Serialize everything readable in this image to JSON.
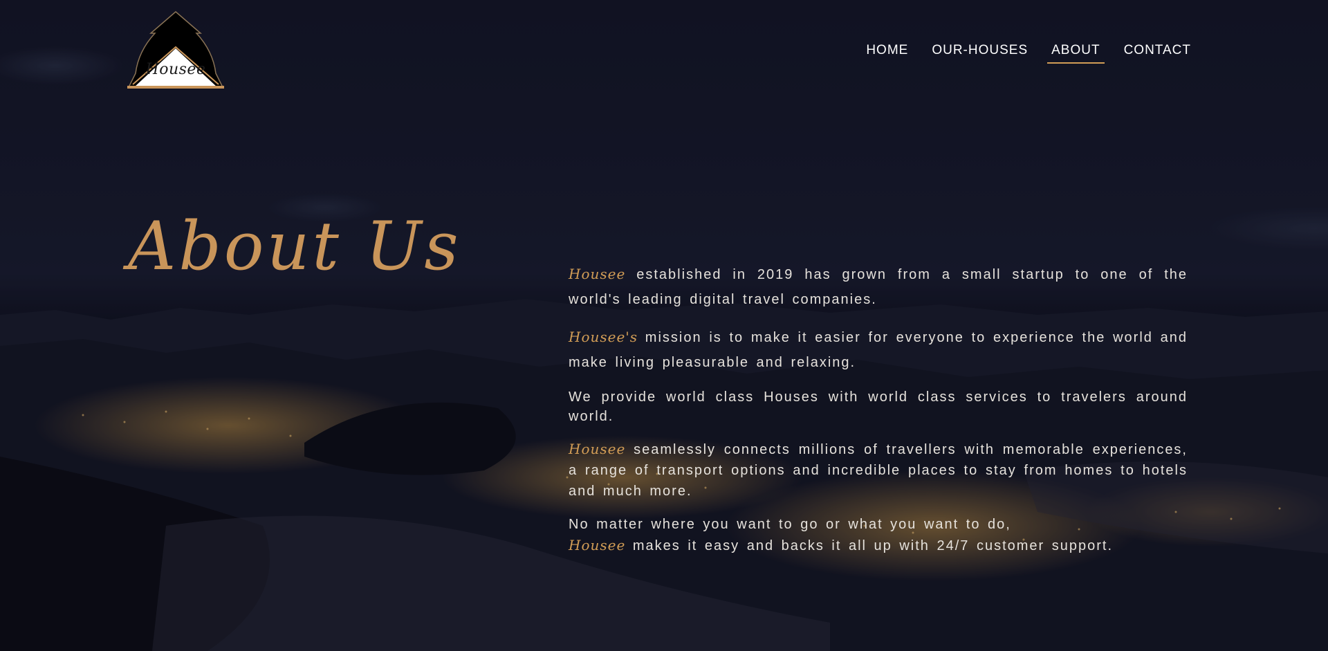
{
  "logo": {
    "text": "Housee"
  },
  "nav": {
    "home": "HOME",
    "houses": "OUR-HOUSES",
    "about": "ABOUT",
    "contact": "CONTACT"
  },
  "hero": {
    "title": "About Us"
  },
  "content": {
    "p1": {
      "brand": "Housee",
      "text": " established in 2019 has grown from a small startup to one of the world's leading digital travel companies."
    },
    "p2": {
      "brand": "Housee's",
      "text": " mission is to make it easier for everyone to experience the world and make living pleasurable and relaxing."
    },
    "p3": {
      "text": "We provide world class Houses with world class services to travelers around world."
    },
    "p4": {
      "brand": "Housee",
      "text": " seamlessly connects millions of travellers with memorable experiences, a range of transport options and incredible places to stay from homes to hotels and much more."
    },
    "p5": {
      "lead": "No matter where you want to go or what you want to do,",
      "brand": "Housee",
      "text": " makes it easy and backs it all up with 24/7 customer support."
    }
  },
  "colors": {
    "accent": "#d29d56",
    "title": "#c9955a",
    "background": "#0e0f19",
    "text": "#e6e2dc"
  },
  "icons": {
    "logo": "house-roof-logo"
  }
}
